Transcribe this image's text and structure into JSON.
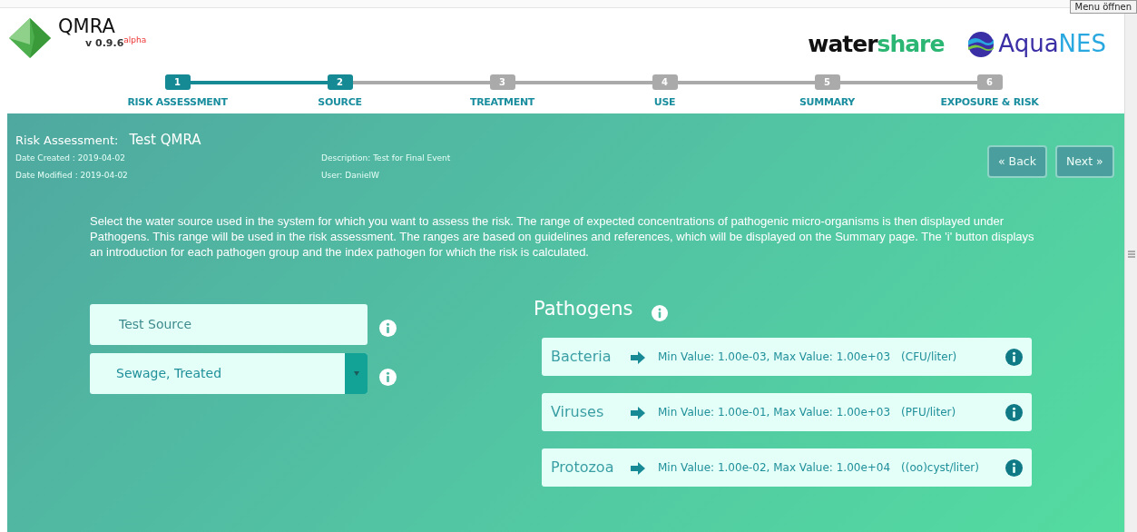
{
  "app": {
    "title": "QMRA",
    "version": "v 0.9.6",
    "version_tag": "alpha"
  },
  "partners": {
    "watershare": [
      "water",
      "share"
    ],
    "aquanes": [
      "Aqua",
      "NES"
    ]
  },
  "tooltip": "Menu öffnen",
  "steps": [
    {
      "number": "1",
      "label": "RISK ASSESSMENT",
      "reached": true
    },
    {
      "number": "2",
      "label": "SOURCE",
      "reached": true
    },
    {
      "number": "3",
      "label": "TREATMENT",
      "reached": false
    },
    {
      "number": "4",
      "label": "USE",
      "reached": false
    },
    {
      "number": "5",
      "label": "SUMMARY",
      "reached": false
    },
    {
      "number": "6",
      "label": "EXPOSURE & RISK",
      "reached": false
    }
  ],
  "assessment": {
    "label": "Risk Assessment:",
    "name": "Test QMRA",
    "date_created": "Date Created : 2019-04-02",
    "date_modified": "Date Modified : 2019-04-02",
    "description": "Description: Test for Final Event",
    "user": "User: DanielW"
  },
  "nav_buttons": [
    "« Back",
    "Next »"
  ],
  "intro": "Select the water source used in the system for which you want to assess the risk. The range of expected concentrations of pathogenic micro-organisms is then displayed under Pathogens. This range will be used in the risk assessment. The ranges are based on guidelines and references, which will be displayed on the Summary page. The 'i' button displays an introduction for each pathogen group and the index pathogen for which the risk is calculated.",
  "source": {
    "name": "Test Source",
    "type": "Sewage, Treated"
  },
  "pathogens": {
    "title": "Pathogens",
    "items": [
      {
        "name": "Bacteria",
        "range": "Min Value: 1.00e-03, Max Value: 1.00e+03",
        "unit": "(CFU/liter)"
      },
      {
        "name": "Viruses",
        "range": "Min Value: 1.00e-01, Max Value: 1.00e+03",
        "unit": "(PFU/liter)"
      },
      {
        "name": "Protozoa",
        "range": "Min Value: 1.00e-02, Max Value: 1.00e+04",
        "unit": "((oo)cyst/liter)"
      }
    ]
  }
}
